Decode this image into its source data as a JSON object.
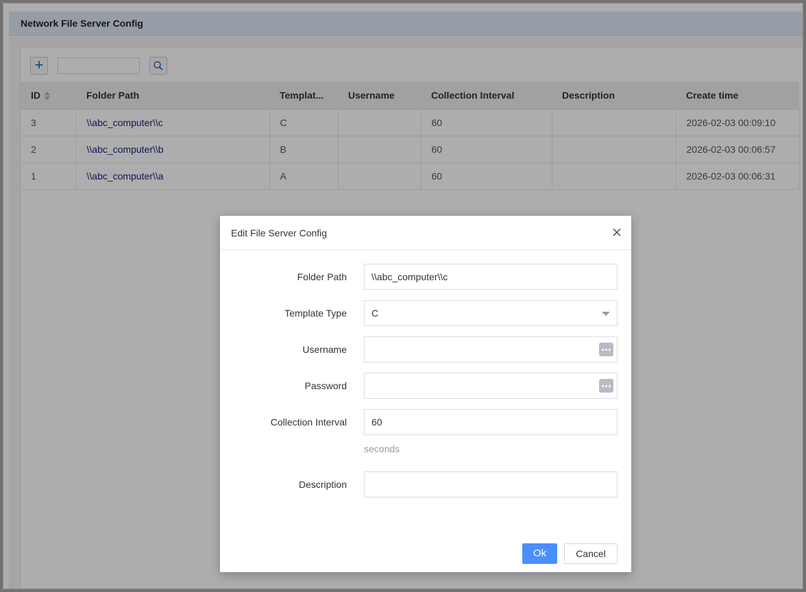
{
  "panel": {
    "title": "Network File Server Config"
  },
  "toolbar": {
    "add_label": "+",
    "search_placeholder": ""
  },
  "table": {
    "columns": [
      "ID",
      "Folder Path",
      "Templat...",
      "Username",
      "Collection Interval",
      "Description",
      "Create time"
    ],
    "rows": [
      {
        "id": "3",
        "folder_path": "\\\\abc_computer\\\\c",
        "template": "C",
        "username": "",
        "interval": "60",
        "description": "",
        "create_time": "2026-02-03 00:09:10"
      },
      {
        "id": "2",
        "folder_path": "\\\\abc_computer\\\\b",
        "template": "B",
        "username": "",
        "interval": "60",
        "description": "",
        "create_time": "2026-02-03 00:06:57"
      },
      {
        "id": "1",
        "folder_path": "\\\\abc_computer\\\\a",
        "template": "A",
        "username": "",
        "interval": "60",
        "description": "",
        "create_time": "2026-02-03 00:06:31"
      }
    ]
  },
  "dialog": {
    "title": "Edit File Server Config",
    "fields": {
      "folder_path": {
        "label": "Folder Path",
        "value": "\\\\abc_computer\\\\c"
      },
      "template_type": {
        "label": "Template Type",
        "value": "C"
      },
      "username": {
        "label": "Username",
        "value": ""
      },
      "password": {
        "label": "Password",
        "value": ""
      },
      "collection_interval": {
        "label": "Collection Interval",
        "value": "60",
        "hint": "seconds"
      },
      "description": {
        "label": "Description",
        "value": ""
      }
    },
    "ok_label": "Ok",
    "cancel_label": "Cancel"
  },
  "colors": {
    "primary": "#4a8eff",
    "link": "#1a237e",
    "header_bg": "#dfe7f5"
  }
}
